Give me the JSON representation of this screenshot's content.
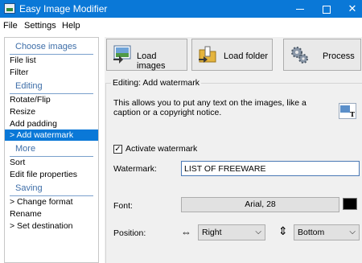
{
  "window": {
    "title": "Easy Image Modifier"
  },
  "menu": [
    "File",
    "Settings",
    "Help"
  ],
  "sidebar": {
    "sections": [
      {
        "header": "Choose images",
        "items": [
          "File list",
          "Filter"
        ]
      },
      {
        "header": "Editing",
        "items": [
          "Rotate/Flip",
          "Resize",
          "Add padding",
          "> Add watermark"
        ]
      },
      {
        "header": "More",
        "items": [
          "Sort",
          "Edit file properties"
        ]
      },
      {
        "header": "Saving",
        "items": [
          "> Change format",
          "Rename",
          "> Set destination"
        ]
      }
    ],
    "active_item": "> Add watermark"
  },
  "toolbar": {
    "load_images": "Load images",
    "load_folder": "Load folder",
    "process": "Process"
  },
  "panel": {
    "title": "Editing: Add watermark",
    "description": "This allows you to put any text on the images, like a caption or a copyright notice.",
    "activate_label": "Activate watermark",
    "activate_checked": true,
    "watermark_label": "Watermark:",
    "watermark_value": "LIST OF FREEWARE",
    "font_label": "Font:",
    "font_value": "Arial, 28",
    "font_color": "#000000",
    "position_label": "Position:",
    "horizontal": "Right",
    "vertical": "Bottom"
  },
  "colors": {
    "titlebar": "#0a78d7",
    "sidebar_header": "#3e6ea8",
    "selection": "#0a78d7"
  }
}
